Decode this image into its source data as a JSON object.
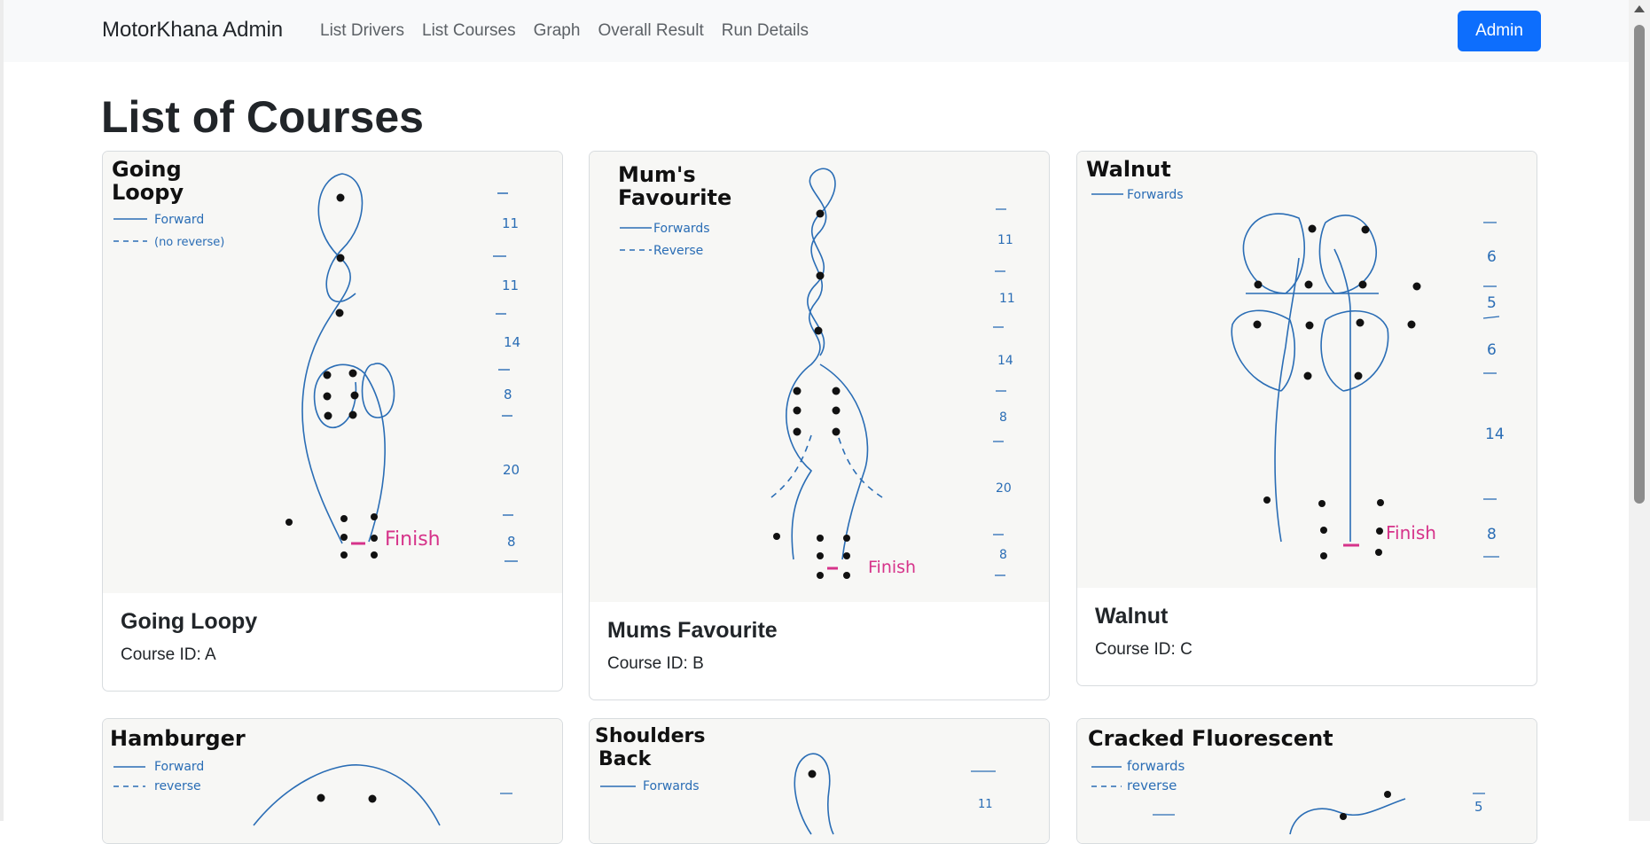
{
  "nav": {
    "brand": "MotorKhana Admin",
    "links": [
      "List Drivers",
      "List Courses",
      "Graph",
      "Overall Result",
      "Run Details"
    ],
    "admin_label": "Admin"
  },
  "page": {
    "title": "List of Courses"
  },
  "courses": [
    {
      "title": "Going Loopy",
      "id_text": "Course ID: A",
      "sketch": {
        "heading": [
          "Going",
          "Loopy"
        ],
        "legend": [
          "Forward",
          "(no reverse)"
        ],
        "finish": "Finish",
        "distances": [
          "11",
          "11",
          "14",
          "8",
          "20",
          "8"
        ]
      }
    },
    {
      "title": "Mums Favourite",
      "id_text": "Course ID: B",
      "sketch": {
        "heading": [
          "Mum's",
          "Favourite"
        ],
        "legend": [
          "Forwards",
          "Reverse"
        ],
        "finish": "Finish",
        "distances": [
          "11",
          "11",
          "14",
          "8",
          "20",
          "8"
        ]
      }
    },
    {
      "title": "Walnut",
      "id_text": "Course ID: C",
      "sketch": {
        "heading": [
          "Walnut"
        ],
        "legend": [
          "Forwards"
        ],
        "finish": "Finish",
        "distances": [
          "6",
          "5",
          "6",
          "14",
          "8"
        ]
      }
    },
    {
      "sketch": {
        "heading": [
          "Hamburger"
        ],
        "legend": [
          "Forward",
          "reverse"
        ]
      }
    },
    {
      "sketch": {
        "heading": [
          "Shoulders",
          "Back"
        ],
        "legend": [
          "Forwards"
        ],
        "distances": [
          "11"
        ]
      }
    },
    {
      "sketch": {
        "heading": [
          "Cracked Fluorescent"
        ],
        "legend": [
          "forwards",
          "reverse"
        ],
        "distances": [
          "5"
        ]
      }
    }
  ],
  "colors": {
    "ink_blue": "#2a6db5",
    "finish_pink": "#d6338a",
    "primary": "#0d6efd"
  }
}
